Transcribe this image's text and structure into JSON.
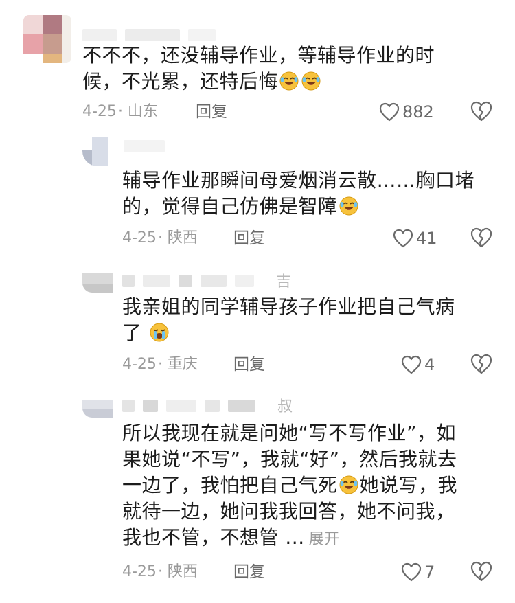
{
  "comments": [
    {
      "text_lines": [
        "不不不，还没辅导作业，等辅导作业的时",
        "候，不光累，还特后悔"
      ],
      "emojis": [
        "laugh-cry-emoji",
        "laugh-cry-emoji"
      ],
      "date": "4-25",
      "location": "· 山东",
      "reply": "回复",
      "likes": "882"
    },
    {
      "text_lines": [
        "辅导作业那瞬间母爱烟消云散……胸口堵",
        "的，觉得自己仿佛是智障"
      ],
      "emojis": [
        "laugh-cry-emoji"
      ],
      "date": "4-25",
      "location": "· 陕西",
      "reply": "回复",
      "likes": "41"
    },
    {
      "name_fragment": "吉",
      "text_lines": [
        "我亲姐的同学辅导孩子作业把自己气病",
        "了"
      ],
      "emojis": [
        "crying-emoji"
      ],
      "date": "4-25",
      "location": "· 重庆",
      "reply": "回复",
      "likes": "4"
    },
    {
      "name_fragment": "叔",
      "text_lines": [
        "所以我现在就是问她“写不写作业”，如",
        "果她说“不写”，我就“好”，然后我就去",
        "一边了，我怕把自己气死",
        "她说写，我",
        "就待一边，她问我我回答，她不问我，",
        "我也不管，不想管 ..."
      ],
      "emojis": [
        "laugh-cry-emoji"
      ],
      "expand": "展开",
      "date": "4-25",
      "location": "· 陕西",
      "reply": "回复",
      "likes": "7"
    }
  ],
  "colors": {
    "text": "#1c1c1c",
    "meta": "#9a9a9a",
    "action": "#6a6a6a",
    "emoji_face": "#f7c23c"
  }
}
